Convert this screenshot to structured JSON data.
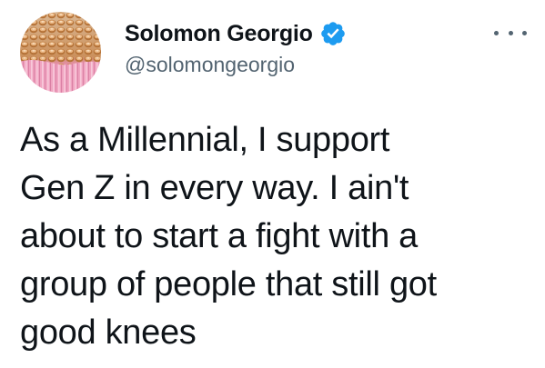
{
  "author": {
    "display_name": "Solomon Georgio",
    "handle": "@solomongeorgio",
    "verified": true
  },
  "tweet": {
    "text": "As a Millennial, I support\nGen Z in every way. I ain't\nabout to start a fight with a\ngroup of people that still got\ngood knees"
  },
  "icons": {
    "verified": "verified-badge-icon",
    "more": "more-options-icon"
  },
  "colors": {
    "text": "#0f1419",
    "secondary": "#536471",
    "verified": "#1d9bf0",
    "background": "#ffffff"
  }
}
